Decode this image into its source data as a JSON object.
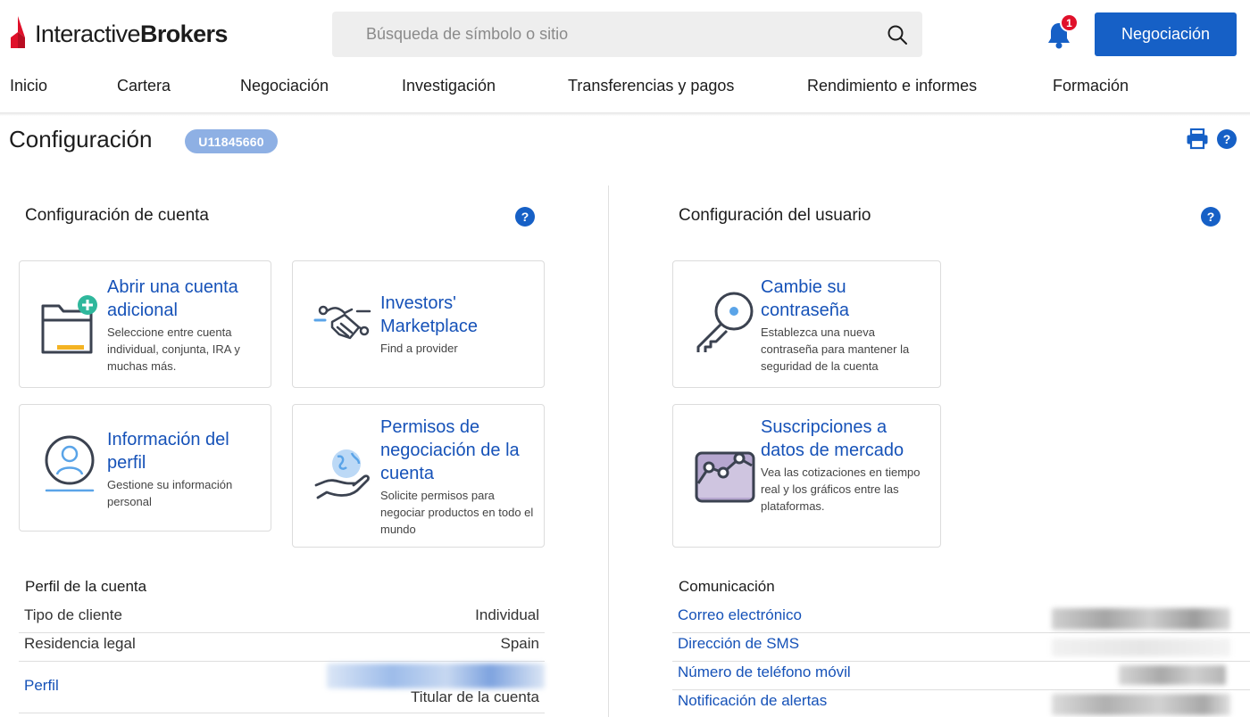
{
  "header": {
    "logo_prefix": "Interactive",
    "logo_suffix": "Brokers",
    "search_placeholder": "Búsqueda de símbolo o sitio",
    "notification_count": "1",
    "trade_button": "Negociación",
    "nav": [
      "Inicio",
      "Cartera",
      "Negociación",
      "Investigación",
      "Transferencias y pagos",
      "Rendimiento e informes",
      "Formación"
    ]
  },
  "page": {
    "title": "Configuración",
    "account_id": "U11845660",
    "help_glyph": "?"
  },
  "account_settings": {
    "title": "Configuración de cuenta",
    "cards": [
      {
        "title": "Abrir una cuenta adicional",
        "desc": "Seleccione entre cuenta individual, conjunta, IRA y muchas más.",
        "icon": "folder-add-icon"
      },
      {
        "title": "Investors' Marketplace",
        "desc": "Find a provider",
        "icon": "handshake-icon"
      },
      {
        "title": "Información del perfil",
        "desc": "Gestione su información personal",
        "icon": "profile-icon"
      },
      {
        "title": "Permisos de negociación de la cuenta",
        "desc": "Solicite permisos para negociar productos en todo el mundo",
        "icon": "globe-hand-icon"
      }
    ]
  },
  "user_settings": {
    "title": "Configuración del usuario",
    "cards": [
      {
        "title": "Cambie su contraseña",
        "desc": "Establezca una nueva contraseña para mantener la seguridad de la cuenta",
        "icon": "key-icon"
      },
      {
        "title": "Suscripciones a datos de mercado",
        "desc": "Vea las cotizaciones en tiempo real y los gráficos entre las plataformas.",
        "icon": "market-chart-icon"
      }
    ]
  },
  "account_profile": {
    "title": "Perfil de la cuenta",
    "rows": [
      {
        "label": "Tipo de cliente",
        "value": "Individual"
      },
      {
        "label": "Residencia legal",
        "value": "Spain"
      },
      {
        "label": "Perfil",
        "value": "Titular de la cuenta"
      }
    ]
  },
  "communication": {
    "title": "Comunicación",
    "rows": [
      "Correo electrónico",
      "Dirección de SMS",
      "Número de teléfono móvil",
      "Notificación de alertas"
    ]
  },
  "colors": {
    "brand_red": "#e0102a",
    "accent_blue": "#1660c6",
    "link_blue": "#1652b8"
  }
}
